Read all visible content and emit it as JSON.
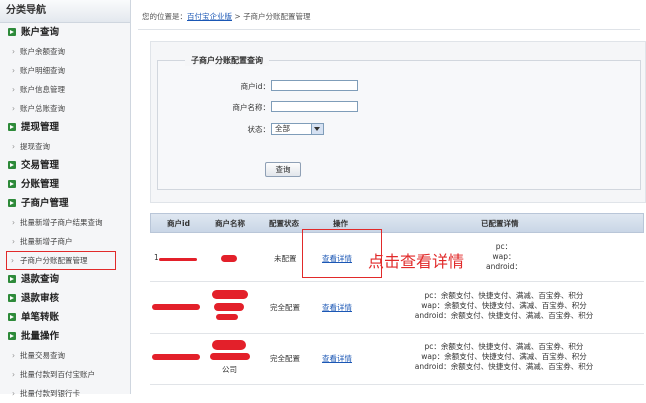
{
  "sidebar": {
    "title": "分类导航",
    "groups": [
      {
        "label": "账户查询",
        "items": [
          "账户余额查询",
          "账户明细查询",
          "账户信息管理",
          "账户总账查询"
        ]
      },
      {
        "label": "提现管理",
        "items": [
          "提现查询"
        ]
      },
      {
        "label": "交易管理",
        "items": []
      },
      {
        "label": "分账管理",
        "items": []
      },
      {
        "label": "子商户管理",
        "items": [
          "批量新增子商户结果查询",
          "批量新增子商户",
          "子商户分账配置管理"
        ]
      },
      {
        "label": "退款查询",
        "items": []
      },
      {
        "label": "退款审核",
        "items": []
      },
      {
        "label": "单笔转账",
        "items": []
      },
      {
        "label": "批量操作",
        "items": [
          "批量交易查询",
          "批量付款到百付宝账户",
          "批量付款到银行卡"
        ]
      }
    ]
  },
  "breadcrumb": {
    "prefix": "您的位置是：",
    "link": "百付宝企业版",
    "sep": " > ",
    "current": "子商户分账配置管理"
  },
  "query": {
    "title": "子商户分账配置查询",
    "id_label": "商户id：",
    "name_label": "商户名称：",
    "status_label": "状态：",
    "status_value": "全部",
    "submit": "查询"
  },
  "table": {
    "headers": [
      "商户id",
      "商户名称",
      "配置状态",
      "操作",
      "已配置详情"
    ],
    "rows": [
      {
        "id": "1",
        "name": "",
        "status": "未配置",
        "action": "查看详情",
        "details": [
          "pc：",
          "wap：",
          "android："
        ]
      },
      {
        "id": "",
        "name": "",
        "status": "完全配置",
        "action": "查看详情",
        "details": [
          "pc：余额支付、快捷支付、满减、百宝券、积分",
          "wap：余额支付、快捷支付、满减、百宝券、积分",
          "android：余额支付、快捷支付、满减、百宝券、积分"
        ]
      },
      {
        "id": "",
        "name": "公司",
        "status": "完全配置",
        "action": "查看详情",
        "details": [
          "pc：余额支付、快捷支付、满减、百宝券、积分",
          "wap：余额支付、快捷支付、满减、百宝券、积分",
          "android：余额支付、快捷支付、满减、百宝券、积分"
        ]
      }
    ]
  },
  "annotation": "点击查看详情",
  "colors": {
    "accent": "#1b57b5",
    "annotation": "#e12a2a",
    "group_icon": "#2e8a3a"
  }
}
